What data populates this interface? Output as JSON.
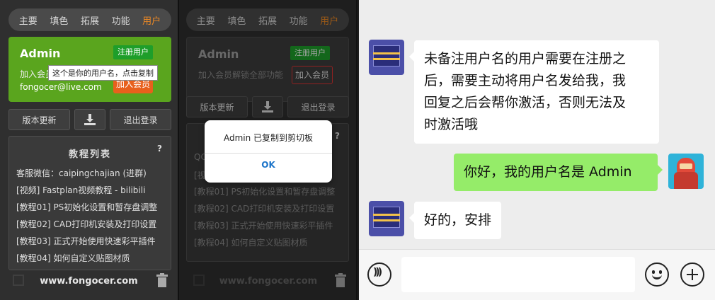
{
  "tabs": [
    "主要",
    "填色",
    "拓展",
    "功能",
    "用户"
  ],
  "panel1": {
    "card": {
      "name": "Admin",
      "register_label": "注册用户",
      "subtitle": "加入会员",
      "email": "fongocer@live.com",
      "join_label": "加入会员",
      "tooltip": "这个是你的用户名，点击复制"
    },
    "buttons": {
      "update": "版本更新",
      "logout": "退出登录"
    },
    "tutorial": {
      "title": "教程列表",
      "help": "?",
      "items": [
        "客服微信：caipingchajian (进群)",
        "[视频] Fastplan视频教程 - bilibili",
        "[教程01] PS初始化设置和暂存盘调整",
        "[教程02] CAD打印机安装及打印设置",
        "[教程03] 正式开始使用快速彩平插件",
        "[教程04] 如何自定义贴图材质"
      ]
    },
    "footer": "www.fongocer.com"
  },
  "panel2": {
    "card": {
      "name": "Admin",
      "register_label": "注册用户",
      "subtitle": "加入会员解锁全部功能",
      "join_label": "加入会员"
    },
    "buttons": {
      "update": "版本更新",
      "logout": "退出登录"
    },
    "tutorial": {
      "help": "?",
      "partial_qc": "QC",
      "partial_video": "[视",
      "items": [
        "[教程01] PS初始化设置和暂存盘调整",
        "[教程02] CAD打印机安装及打印设置",
        "[教程03] 正式开始使用快速彩平插件",
        "[教程04] 如何自定义贴图材质"
      ]
    },
    "dialog": {
      "message": "Admin 已复制到剪切板",
      "ok": "OK"
    },
    "footer": "www.fongocer.com"
  },
  "chat": {
    "messages": [
      {
        "side": "left",
        "lines": [
          "未备注用户名的用户需要在注册之",
          "后，需要主动将用户名发给我，我",
          "回复之后会帮你激活，否则无法及",
          "时激活哦"
        ]
      },
      {
        "side": "right",
        "lines": [
          "你好，我的用户名是 Admin"
        ]
      },
      {
        "side": "left",
        "lines": [
          "好的，安排"
        ]
      }
    ]
  }
}
